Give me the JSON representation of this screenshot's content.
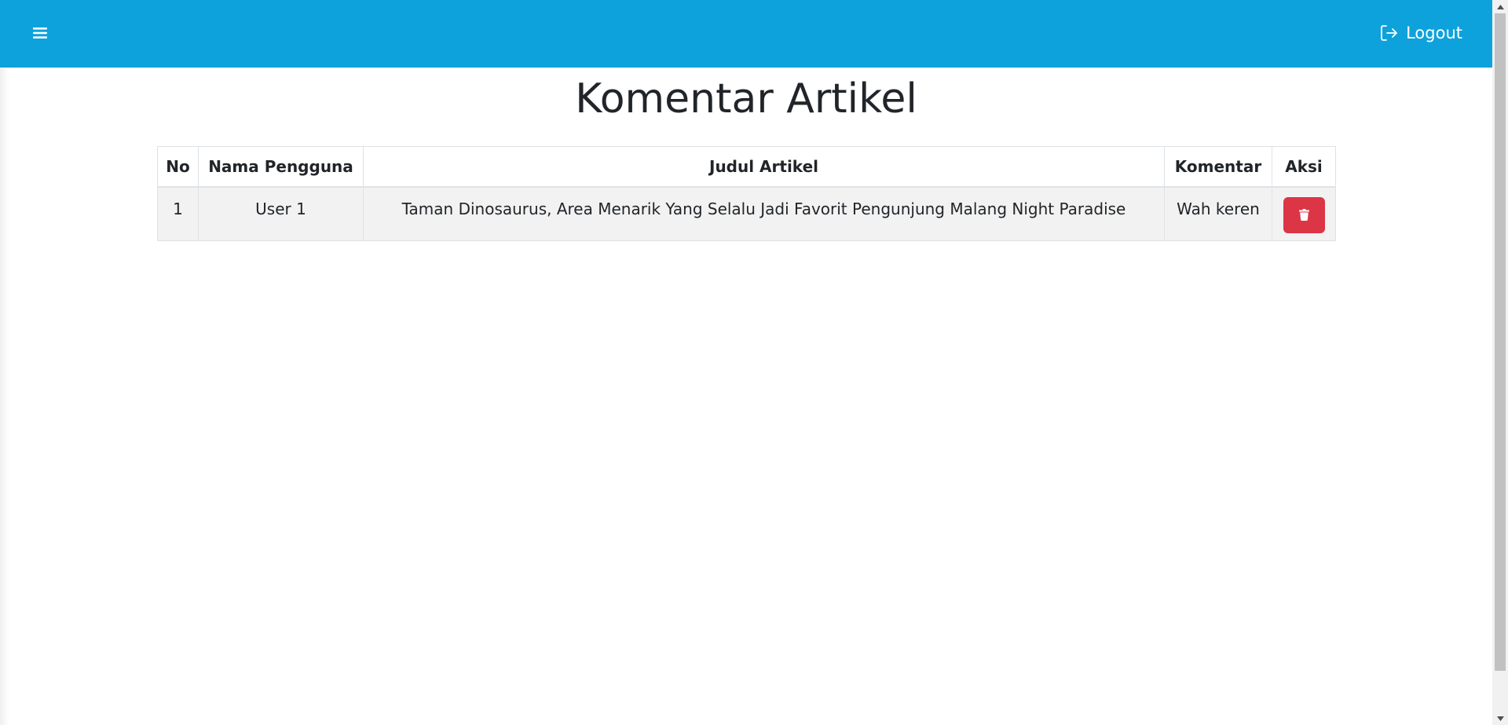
{
  "navbar": {
    "background": "#0ea2dc",
    "menu_icon": "hamburger-icon",
    "logout_icon": "logout-icon",
    "logout_label": "Logout"
  },
  "page": {
    "title": "Komentar Artikel"
  },
  "table": {
    "headers": [
      "No",
      "Nama Pengguna",
      "Judul Artikel",
      "Komentar",
      "Aksi"
    ],
    "rows": [
      {
        "no": "1",
        "nama_pengguna": "User 1",
        "judul_artikel": "Taman Dinosaurus, Area Menarik Yang Selalu Jadi Favorit Pengunjung Malang Night Paradise",
        "komentar": "Wah keren",
        "action_icon": "trash-icon",
        "action_color": "#dc3545"
      }
    ]
  }
}
